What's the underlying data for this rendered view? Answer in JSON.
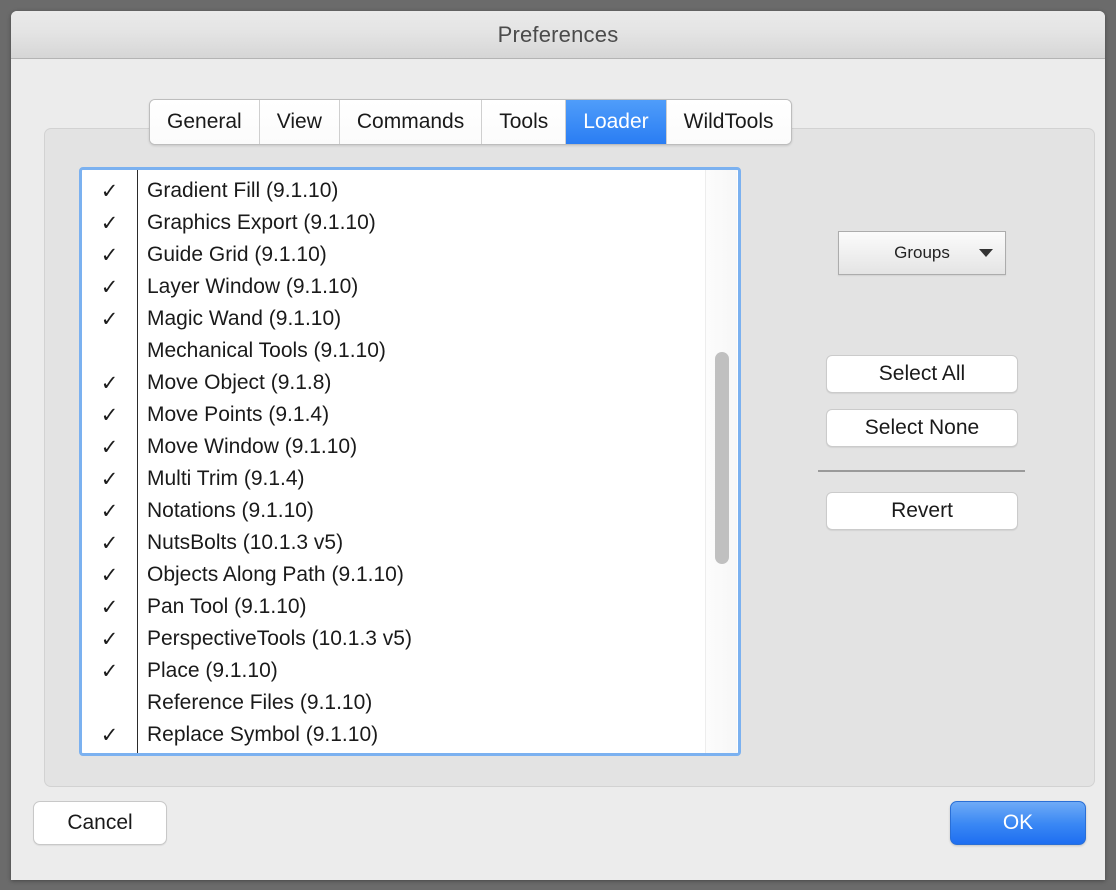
{
  "window": {
    "title": "Preferences"
  },
  "tabs": [
    {
      "label": "General",
      "selected": false
    },
    {
      "label": "View",
      "selected": false
    },
    {
      "label": "Commands",
      "selected": false
    },
    {
      "label": "Tools",
      "selected": false
    },
    {
      "label": "Loader",
      "selected": true
    },
    {
      "label": "WildTools",
      "selected": false
    }
  ],
  "loader_panel": {
    "list": {
      "check_glyph": "✓",
      "items": [
        {
          "name": "Gradient Fill (9.1.10)",
          "checked": true
        },
        {
          "name": "Graphics Export (9.1.10)",
          "checked": true
        },
        {
          "name": "Guide Grid (9.1.10)",
          "checked": true
        },
        {
          "name": "Layer Window (9.1.10)",
          "checked": true
        },
        {
          "name": "Magic Wand (9.1.10)",
          "checked": true
        },
        {
          "name": "Mechanical Tools (9.1.10)",
          "checked": false
        },
        {
          "name": "Move Object (9.1.8)",
          "checked": true
        },
        {
          "name": "Move Points (9.1.4)",
          "checked": true
        },
        {
          "name": "Move Window (9.1.10)",
          "checked": true
        },
        {
          "name": "Multi Trim (9.1.4)",
          "checked": true
        },
        {
          "name": "Notations (9.1.10)",
          "checked": true
        },
        {
          "name": "NutsBolts (10.1.3 v5)",
          "checked": true
        },
        {
          "name": "Objects Along Path (9.1.10)",
          "checked": true
        },
        {
          "name": "Pan Tool (9.1.10)",
          "checked": true
        },
        {
          "name": "PerspectiveTools (10.1.3 v5)",
          "checked": true
        },
        {
          "name": "Place (9.1.10)",
          "checked": true
        },
        {
          "name": "Reference Files (9.1.10)",
          "checked": false
        },
        {
          "name": "Replace Symbol (9.1.10)",
          "checked": true
        }
      ]
    },
    "groups_button": {
      "label": "Groups",
      "icon": "chevron-down-icon"
    },
    "select_all_label": "Select All",
    "select_none_label": "Select None",
    "revert_label": "Revert"
  },
  "footer": {
    "cancel_label": "Cancel",
    "ok_label": "OK"
  },
  "colors": {
    "accent_blue": "#2a7df3",
    "focus_ring": "#7bb1f0",
    "window_bg": "#ececec",
    "panel_bg": "#e3e3e3",
    "desktop_bg": "#6b6b6b"
  }
}
